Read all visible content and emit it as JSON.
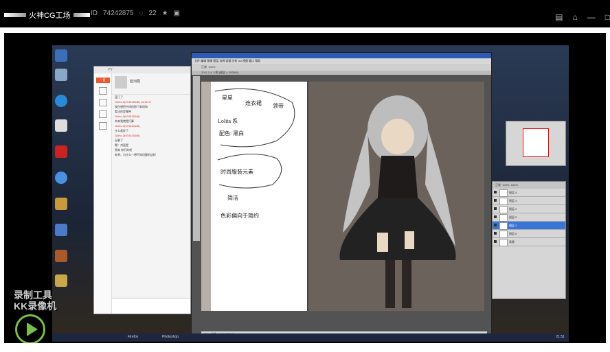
{
  "header": {
    "brand": "火神CG工场",
    "id_label": "ID",
    "id_value": "74242875",
    "followers": "22",
    "star_icon": "star-icon",
    "share_icon": "share-icon"
  },
  "controls": {
    "icons": [
      "document-icon",
      "home-icon",
      "minimize-icon",
      "restore-icon"
    ]
  },
  "chat": {
    "tab_label": "一直",
    "profile_name": "蓝河霞",
    "messages": [
      {
        "text": "蓝汀了",
        "red": false
      },
      {
        "text": "GoHo-3(974515346) 13:42:17",
        "red": true
      },
      {
        "text": "现在想把中间的那个斜线和",
        "red": false
      },
      {
        "text": "看法的是哪种",
        "red": false
      },
      {
        "text": "GoHo-3(974515346)",
        "red": true
      },
      {
        "text": "本来我就是打算",
        "red": false
      },
      {
        "text": "GoHo-3(974315346)",
        "red": true
      },
      {
        "text": "什么就好了",
        "red": false
      },
      {
        "text": "GoHo-3(974315346)",
        "red": true
      },
      {
        "text": "无聊了",
        "red": false
      },
      {
        "text": "嗯！对面是",
        "red": false
      },
      {
        "text": "原来 你们的吧",
        "red": false
      },
      {
        "text": "老师，为什么一想不知问题的这样",
        "red": false
      }
    ]
  },
  "photoshop": {
    "mode_label": "正常",
    "opacity": "100%",
    "zoom": "25%",
    "doc_tab": "2011 2-4 人物 (图层 4, RGB/8)",
    "status": "文档: 26.8M/73.6M"
  },
  "sketch_notes": [
    "星星",
    "连衣裙",
    "领带",
    "Lolita 系",
    "配色: 黑白",
    "时尚服装元素",
    "简洁",
    "色彩偏向于简约"
  ],
  "layers": {
    "blend": "正常",
    "opacity": "100%",
    "fill": "100%",
    "items": [
      "图层 4",
      "图层 3",
      "图层 2",
      "图层 5",
      "图层 1",
      "图层 6",
      "背景"
    ],
    "selected_index": 4
  },
  "watermark": {
    "line1": "录制工具",
    "line2": "KK录像机"
  },
  "taskbar": {
    "time": "21:51",
    "app1": "Firefox",
    "app2": "Photoshop"
  }
}
